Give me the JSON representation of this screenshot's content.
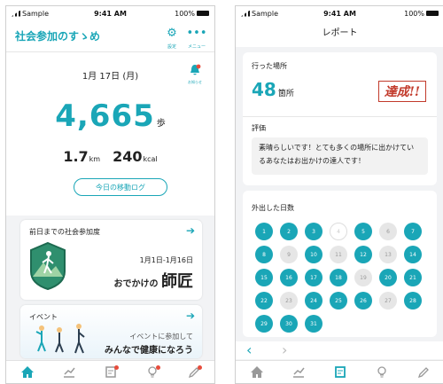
{
  "status": {
    "carrier": "Sample",
    "time": "9:41 AM",
    "battery": "100%"
  },
  "home": {
    "app_title": "社会参加のすゝめ",
    "settings_label": "設定",
    "menu_label": "メニュー",
    "date": "1月 17日 (月)",
    "bell_label": "お知らせ",
    "steps": "4,665",
    "steps_unit": "歩",
    "distance": "1.7",
    "distance_unit": "km",
    "calories": "240",
    "calories_unit": "kcal",
    "log_button": "今日の移動ログ",
    "social_card": {
      "title": "前日までの社会参加度",
      "period": "1月1日-1月16日",
      "rank_prefix": "おでかけの",
      "rank": "師匠"
    },
    "event_card": {
      "title": "イベント",
      "line1": "イベントに参加して",
      "line2": "みんなで健康になろう"
    },
    "tabs": [
      "home",
      "chart",
      "report",
      "tips",
      "edit"
    ]
  },
  "report": {
    "title": "レポート",
    "places_label": "行った場所",
    "places_count": "48",
    "places_unit": "箇所",
    "stamp": "達成!!",
    "eval_label": "評価",
    "comment": "素晴らしいです！とても多くの場所に出かけているあなたはお出かけの達人です！",
    "days_label": "外出した日数",
    "days": [
      {
        "n": "1",
        "s": "on"
      },
      {
        "n": "2",
        "s": "on"
      },
      {
        "n": "3",
        "s": "on"
      },
      {
        "n": "4",
        "s": "cur"
      },
      {
        "n": "5",
        "s": "on"
      },
      {
        "n": "6",
        "s": "off"
      },
      {
        "n": "7",
        "s": "on"
      },
      {
        "n": "8",
        "s": "on"
      },
      {
        "n": "9",
        "s": "off"
      },
      {
        "n": "10",
        "s": "on"
      },
      {
        "n": "11",
        "s": "off"
      },
      {
        "n": "12",
        "s": "on"
      },
      {
        "n": "13",
        "s": "off"
      },
      {
        "n": "14",
        "s": "on"
      },
      {
        "n": "15",
        "s": "on"
      },
      {
        "n": "16",
        "s": "on"
      },
      {
        "n": "17",
        "s": "on"
      },
      {
        "n": "18",
        "s": "on"
      },
      {
        "n": "19",
        "s": "off"
      },
      {
        "n": "20",
        "s": "on"
      },
      {
        "n": "21",
        "s": "on"
      },
      {
        "n": "22",
        "s": "on"
      },
      {
        "n": "23",
        "s": "off"
      },
      {
        "n": "24",
        "s": "on"
      },
      {
        "n": "25",
        "s": "on"
      },
      {
        "n": "26",
        "s": "on"
      },
      {
        "n": "27",
        "s": "off"
      },
      {
        "n": "28",
        "s": "on"
      },
      {
        "n": "29",
        "s": "on"
      },
      {
        "n": "30",
        "s": "on"
      },
      {
        "n": "31",
        "s": "on"
      }
    ]
  },
  "colors": {
    "accent": "#1aa6b7",
    "stamp": "#c23a2b",
    "notify": "#e74c3c"
  }
}
